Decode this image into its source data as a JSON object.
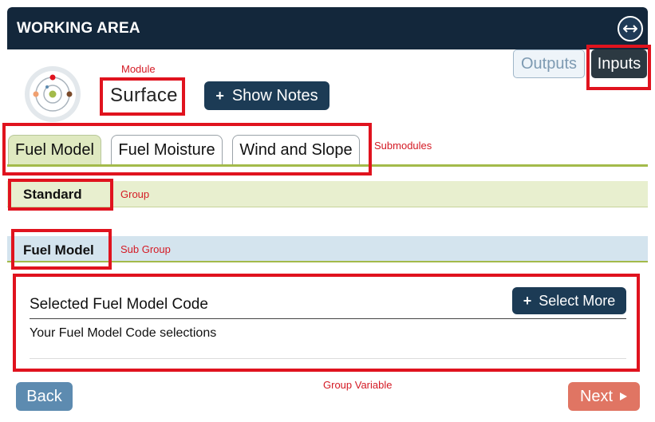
{
  "header": {
    "title": "WORKING AREA",
    "expand_icon": "arrows-horizontal-icon"
  },
  "mode_toggle": {
    "outputs_label": "Outputs",
    "inputs_label": "Inputs"
  },
  "module": {
    "icon": "surface-module-icon",
    "name": "Surface",
    "show_notes_label": "Show Notes"
  },
  "submodules": {
    "tabs": [
      {
        "label": "Fuel Model",
        "active": true
      },
      {
        "label": "Fuel Moisture",
        "active": false
      },
      {
        "label": "Wind and Slope",
        "active": false
      }
    ]
  },
  "group": {
    "label": "Standard"
  },
  "subgroup": {
    "label": "Fuel Model"
  },
  "group_variable": {
    "title": "Selected Fuel Model Code",
    "subtitle": "Your Fuel Model Code selections",
    "select_more_label": "Select More"
  },
  "footer": {
    "back_label": "Back",
    "next_label": "Next"
  },
  "annotations": {
    "module": "Module",
    "submodules": "Submodules",
    "group": "Group",
    "sub_group": "Sub Group",
    "group_variable": "Group Variable"
  },
  "colors": {
    "header_bg": "#13273b",
    "primary_button": "#1c3b55",
    "back_button": "#5d8bb0",
    "next_button": "#e07563",
    "group_bg": "#e8efcf",
    "subgroup_bg": "#d4e4ee",
    "accent_line": "#a3ba4a",
    "highlight": "#e0131e"
  }
}
